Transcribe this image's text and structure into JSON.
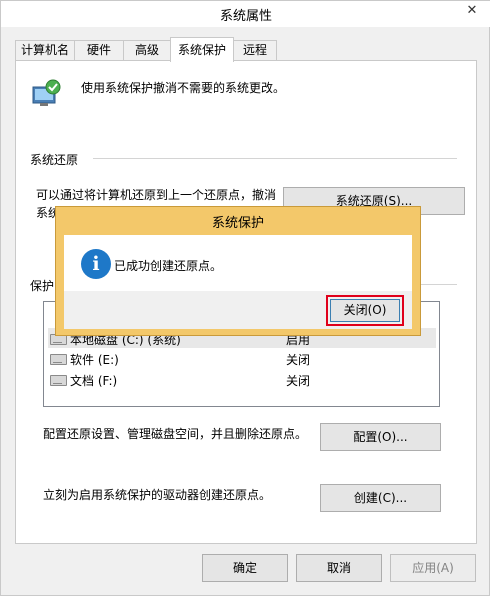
{
  "window": {
    "title": "系统属性",
    "close_glyph": "✕"
  },
  "tabs": [
    {
      "label": "计算机名"
    },
    {
      "label": "硬件"
    },
    {
      "label": "高级"
    },
    {
      "label": "系统保护"
    },
    {
      "label": "远程"
    }
  ],
  "intro": {
    "text": "使用系统保护撤消不需要的系统更改。"
  },
  "restore": {
    "heading": "系统还原",
    "desc_line1": "可以通过将计算机还原到上一个还原点，撤消",
    "desc_line2": "系统",
    "button": "系统还原(S)..."
  },
  "protection": {
    "heading_fragment": "保护",
    "drives": [
      {
        "name": "本地磁盘 (C:) (系统)",
        "status": "启用"
      },
      {
        "name": "软件 (E:)",
        "status": "关闭"
      },
      {
        "name": "文档 (F:)",
        "status": "关闭"
      }
    ],
    "configure_text": "配置还原设置、管理磁盘空间，并且删除还原点。",
    "configure_button": "配置(O)...",
    "create_text": "立刻为启用系统保护的驱动器创建还原点。",
    "create_button": "创建(C)..."
  },
  "footer": {
    "ok": "确定",
    "cancel": "取消",
    "apply": "应用(A)"
  },
  "dialog": {
    "title": "系统保护",
    "icon": "info-icon",
    "message": "已成功创建还原点。",
    "close_button": "关闭(O)",
    "accent": "#f3c86a"
  }
}
